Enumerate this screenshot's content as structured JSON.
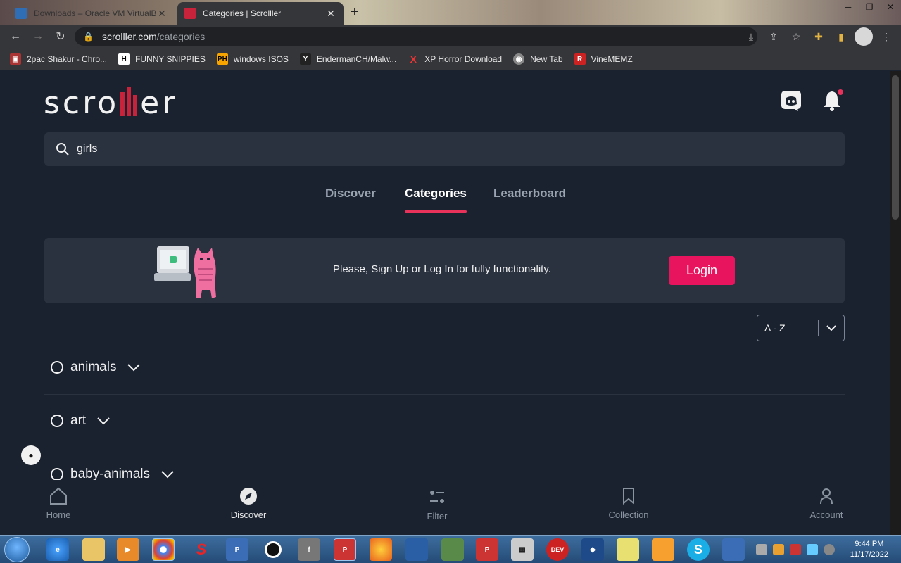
{
  "browser": {
    "tabs": [
      {
        "label": "Downloads – Oracle VM VirtualBox",
        "active": false
      },
      {
        "label": "Categories | Scrolller",
        "active": true
      }
    ],
    "url_host": "scrolller.com",
    "url_path": "/categories",
    "bookmarks": [
      {
        "label": "2pac Shakur - Chro...",
        "icon": "2pac-icon"
      },
      {
        "label": "FUNNY SNIPPIES",
        "icon": "H"
      },
      {
        "label": "windows ISOS",
        "icon": "PH"
      },
      {
        "label": "EndermanCH/Malw...",
        "icon": "YP"
      },
      {
        "label": "XP Horror Download",
        "icon": "X"
      },
      {
        "label": "New Tab",
        "icon": "globe-icon"
      },
      {
        "label": "VineMEMZ",
        "icon": "R"
      }
    ]
  },
  "site": {
    "logo": "scroller",
    "search": {
      "value": "girls",
      "placeholder": "Search"
    },
    "tabs": [
      {
        "label": "Discover",
        "selected": false
      },
      {
        "label": "Categories",
        "selected": true
      },
      {
        "label": "Leaderboard",
        "selected": false
      }
    ],
    "banner": {
      "message": "Please, Sign Up or Log In for fully functionality.",
      "login_label": "Login"
    },
    "sort": {
      "value": "A - Z"
    },
    "categories": [
      "animals",
      "art",
      "baby-animals"
    ],
    "bottom_nav": [
      {
        "label": "Home",
        "icon": "home-icon"
      },
      {
        "label": "Discover",
        "icon": "compass-icon",
        "selected": true
      },
      {
        "label": "Filter",
        "icon": "filter-icon"
      },
      {
        "label": "Collection",
        "icon": "bookmark-icon"
      },
      {
        "label": "Account",
        "icon": "user-icon"
      }
    ],
    "accent": "#e8155e"
  },
  "taskbar": {
    "time": "9:44 PM",
    "date": "11/17/2022"
  }
}
